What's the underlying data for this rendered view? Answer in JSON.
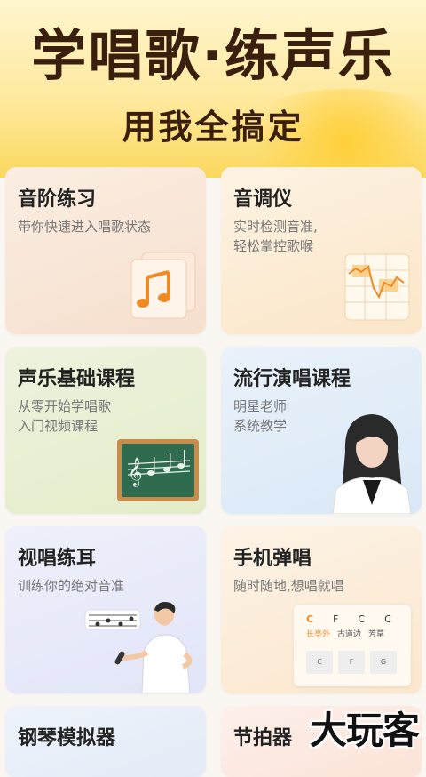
{
  "hero": {
    "title": "学唱歌·练声乐",
    "subtitle": "用我全搞定"
  },
  "cards": [
    {
      "title": "音阶练习",
      "desc": "带你快速进入唱歌状态",
      "icon": "music-notes-icon"
    },
    {
      "title": "音调仪",
      "desc": "实时检测音准,\n轻松掌控歌喉",
      "icon": "pitch-graph-icon"
    },
    {
      "title": "声乐基础课程",
      "desc": "从零开始学唱歌\n入门视频课程",
      "icon": "chalkboard-icon"
    },
    {
      "title": "流行演唱课程",
      "desc": "明星老师\n系统教学",
      "icon": "teacher-avatar"
    },
    {
      "title": "视唱练耳",
      "desc": "训练你的绝对音准",
      "icon": "singer-illustration"
    },
    {
      "title": "手机弹唱",
      "desc": "随时随地,想唱就唱",
      "icon": "chord-sheet-icon"
    },
    {
      "title": "钢琴模拟器",
      "desc": "",
      "icon": "piano-icon"
    },
    {
      "title": "节拍器",
      "desc": "",
      "icon": "metronome-icon"
    }
  ],
  "chord_sheet": {
    "chords": [
      "C",
      "F",
      "C",
      "C"
    ],
    "lyrics": [
      "长亭外",
      "古道边",
      "芳草"
    ],
    "keys": [
      "C",
      "F",
      "G"
    ]
  },
  "colors": {
    "hero_yellow": "#fbd85d",
    "title_brown": "#3a1f0e",
    "accent_orange": "#f08a24"
  },
  "watermark": "大玩客"
}
